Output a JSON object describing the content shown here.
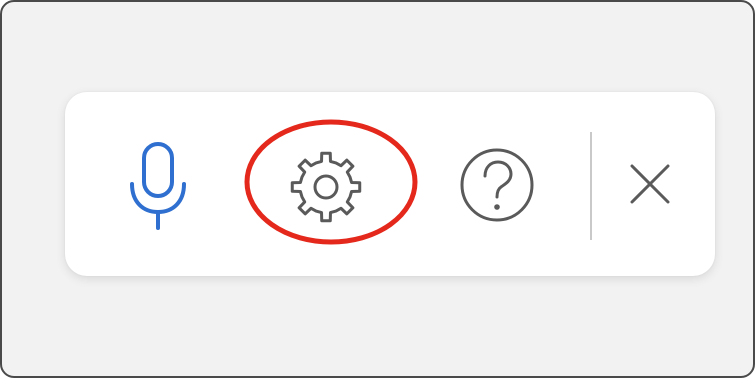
{
  "toolbar": {
    "items": [
      {
        "name": "microphone",
        "icon": "microphone-icon",
        "color": "#2f6fcf"
      },
      {
        "name": "settings",
        "icon": "gear-icon",
        "color": "#5a5a5a"
      },
      {
        "name": "help",
        "icon": "question-circle-icon",
        "color": "#5a5a5a"
      },
      {
        "name": "close",
        "icon": "close-icon",
        "color": "#5a5a5a"
      }
    ],
    "highlight": {
      "target": "settings",
      "color": "#e4281b"
    }
  },
  "colors": {
    "background": "#f2f2f2",
    "toolbar": "#ffffff",
    "divider": "#c9c9c9"
  }
}
